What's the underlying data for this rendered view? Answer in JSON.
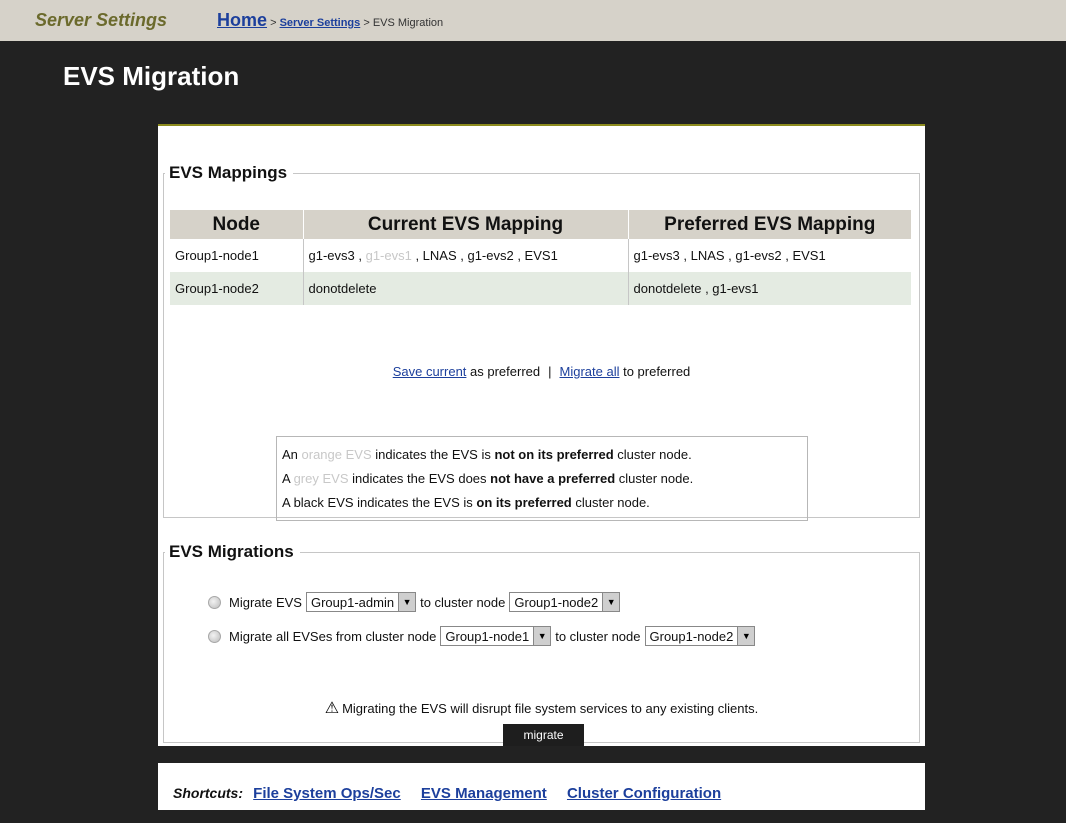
{
  "header": {
    "section_title": "Server Settings",
    "breadcrumb": {
      "home": "Home",
      "sep1": " > ",
      "server_settings": "Server Settings",
      "sep2": " > ",
      "current": "EVS Migration"
    }
  },
  "page_title": "EVS Migration",
  "mappings": {
    "legend": "EVS Mappings",
    "columns": [
      "Node",
      "Current EVS Mapping",
      "Preferred EVS Mapping"
    ],
    "rows": [
      {
        "node": "Group1-node1",
        "current": [
          {
            "text": "g1-evs3 , "
          },
          {
            "text": "g1-evs1",
            "muted": true
          },
          {
            "text": " , LNAS , g1-evs2 , EVS1"
          }
        ],
        "preferred": "g1-evs3 , LNAS , g1-evs2 , EVS1"
      },
      {
        "node": "Group1-node2",
        "current": [
          {
            "text": "donotdelete"
          }
        ],
        "preferred": "donotdelete , g1-evs1"
      }
    ],
    "actions": {
      "save_link": "Save current",
      "save_suffix": " as preferred",
      "separator": "|",
      "migrate_link": "Migrate all",
      "migrate_suffix": " to preferred"
    },
    "key": {
      "line1": {
        "a": "An ",
        "b": "orange EVS",
        "c": " indicates the EVS is ",
        "d": "not on its preferred",
        "e": " cluster node."
      },
      "line2": {
        "a": "A ",
        "b": "grey EVS",
        "c": " indicates the EVS does ",
        "d": "not have a preferred",
        "e": " cluster node."
      },
      "line3": {
        "a": "A black EVS indicates the EVS is ",
        "d": "on its preferred",
        "e": " cluster node."
      }
    }
  },
  "migrations": {
    "legend": "EVS Migrations",
    "option1": {
      "label": "Migrate EVS",
      "evs_value": "Group1-admin",
      "to_label": "to cluster node",
      "node_value": "Group1-node2"
    },
    "option2": {
      "label": "Migrate all EVSes from cluster node",
      "from_value": "Group1-node1",
      "to_label": "to cluster node",
      "node_value": "Group1-node2"
    },
    "warning": "Migrating the EVS will disrupt file system services to any existing clients.",
    "button": "migrate"
  },
  "shortcuts": {
    "label": "Shortcuts:",
    "links": [
      "File System Ops/Sec",
      "EVS Management",
      "Cluster Configuration"
    ]
  },
  "colors": {
    "accent_link": "#1c3f9c",
    "header_bg": "#d6d2c9",
    "page_bg": "#222222",
    "muted_evs": "#c8c8c8"
  }
}
